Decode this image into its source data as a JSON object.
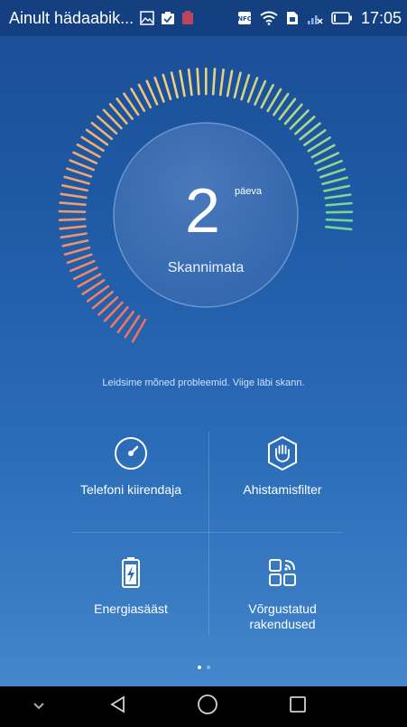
{
  "status_bar": {
    "carrier": "Ainult hädaabik...",
    "time": "17:05",
    "left_icons": [
      "image-icon",
      "clipboard-check-icon",
      "battery-warning-icon"
    ],
    "right_icons": [
      "nfc-icon",
      "wifi-icon",
      "sim-icon",
      "signal-icon",
      "battery-icon"
    ]
  },
  "gauge": {
    "days": "2",
    "days_unit": "päeva",
    "label": "Skannimata",
    "level": 0.85
  },
  "message": "Leidsime mõned probleemid. Viige läbi skann.",
  "tiles": [
    {
      "label": "Telefoni kiirendaja",
      "icon": "speedometer-icon"
    },
    {
      "label": "Ahistamisfilter",
      "icon": "hand-shield-icon"
    },
    {
      "label": "Energiasääst",
      "icon": "battery-charge-icon"
    },
    {
      "label_line1": "Võrgustatud",
      "label_line2": "rakendused",
      "icon": "networked-apps-icon"
    }
  ],
  "pager": {
    "pages": 2,
    "current": 1
  },
  "nav": {
    "buttons": [
      "collapse-icon",
      "back-icon",
      "home-icon",
      "recents-icon"
    ]
  },
  "colors": {
    "background_top": "#1a4d96",
    "background_bottom": "#4a8dd0",
    "gauge_start": "#f07060",
    "gauge_mid": "#f2d27a",
    "gauge_end": "#2fd9a0"
  }
}
